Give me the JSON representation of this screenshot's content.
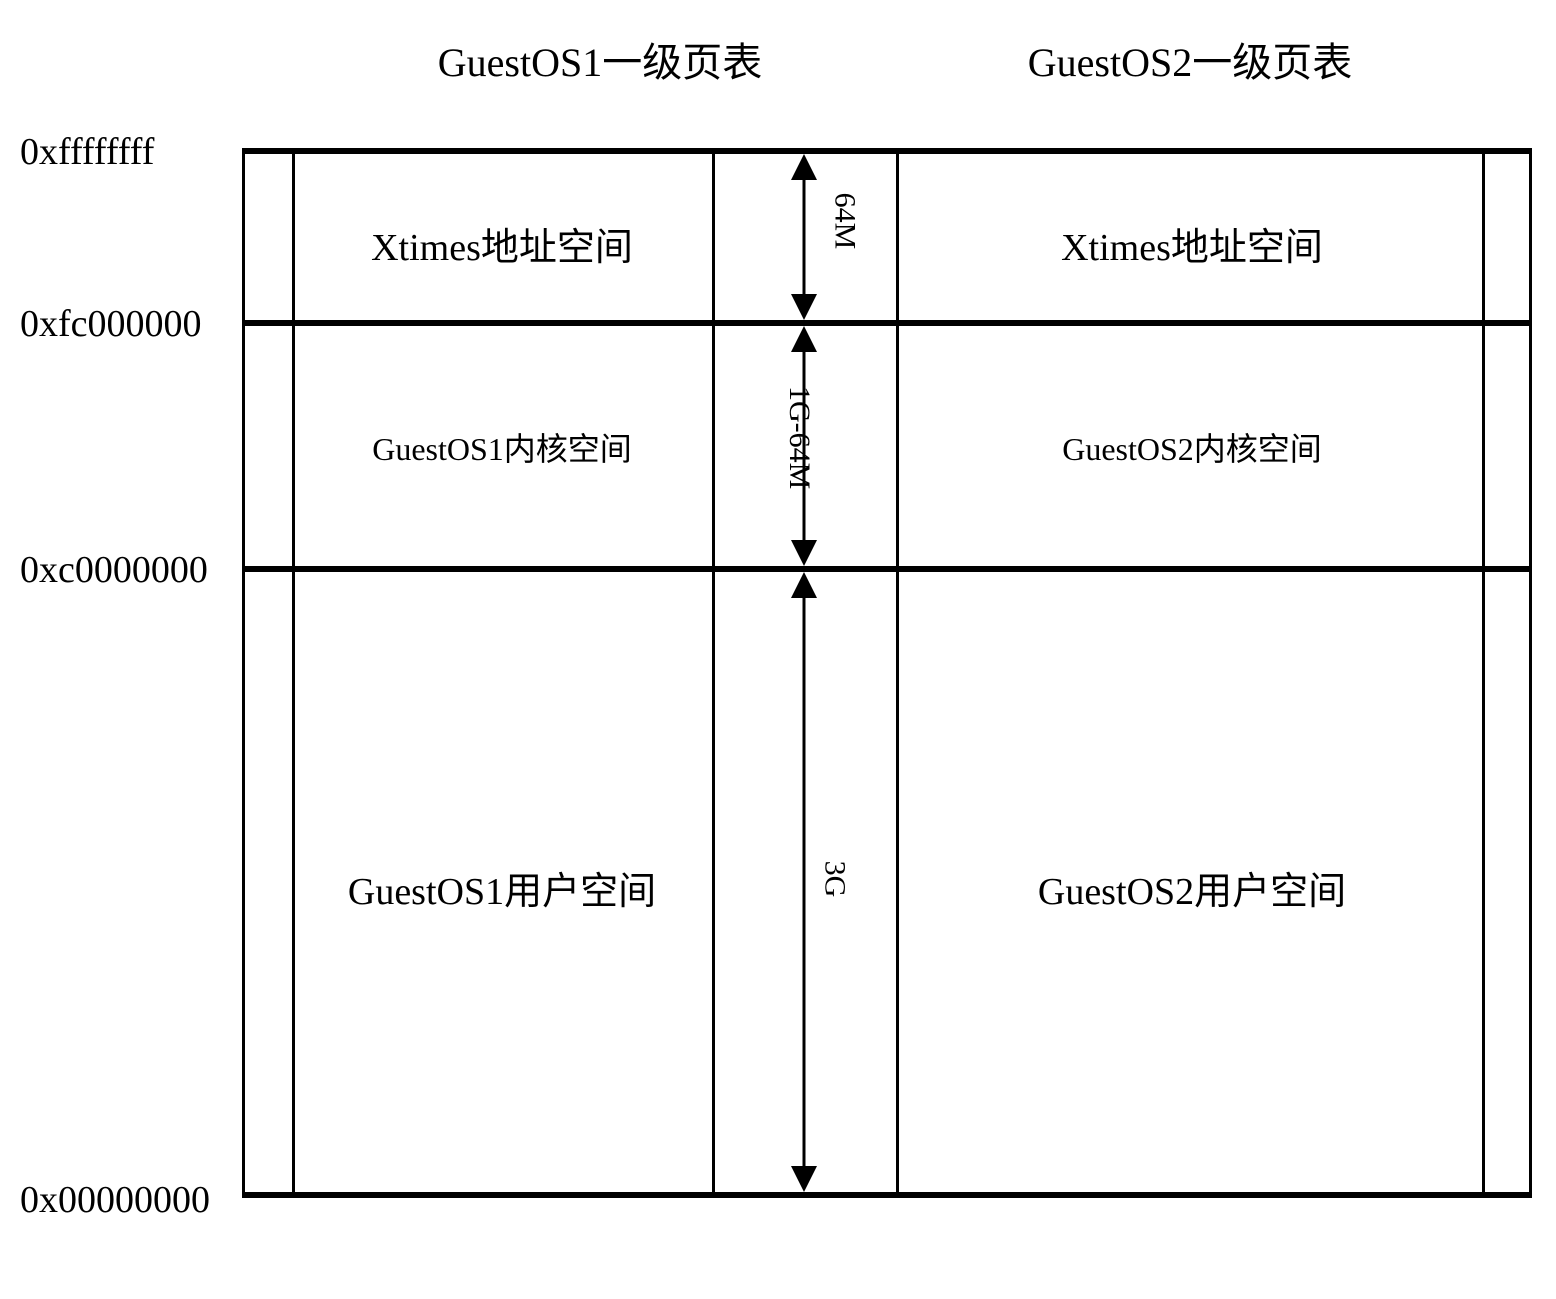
{
  "headers": {
    "left": "GuestOS1一级页表",
    "right": "GuestOS2一级页表"
  },
  "addresses": {
    "top": "0xffffffff",
    "upper": "0xfc000000",
    "lower": "0xc0000000",
    "bottom": "0x00000000"
  },
  "regions": {
    "os1": {
      "xtimes": "Xtimes地址空间",
      "kernel": "GuestOS1内核空间",
      "user": "GuestOS1用户空间"
    },
    "os2": {
      "xtimes": "Xtimes地址空间",
      "kernel": "GuestOS2内核空间",
      "user": "GuestOS2用户空间"
    }
  },
  "sizes": {
    "top": "64M",
    "mid": "1G-64M",
    "bottom": "3G"
  }
}
